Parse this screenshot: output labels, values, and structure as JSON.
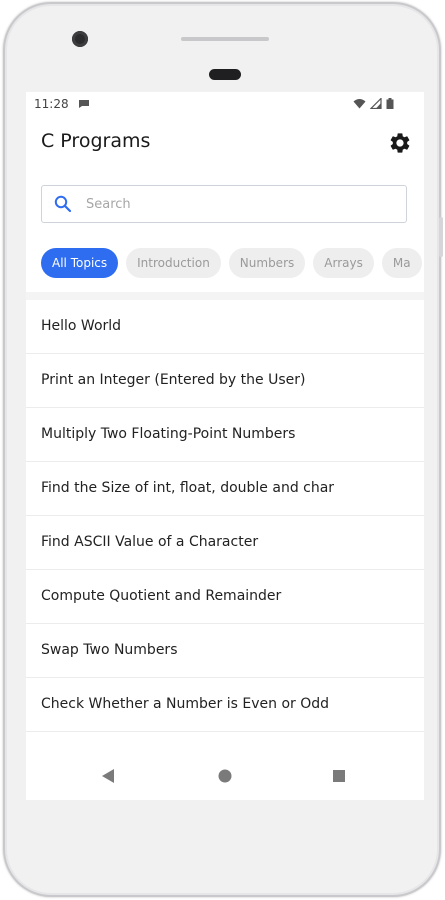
{
  "status_bar": {
    "time": "11:28"
  },
  "app_bar": {
    "title": "C Programs",
    "settings_icon": "gear-icon"
  },
  "search": {
    "placeholder": "Search",
    "value": "",
    "icon": "search-icon"
  },
  "chips": [
    {
      "label": "All Topics",
      "selected": true
    },
    {
      "label": "Introduction",
      "selected": false
    },
    {
      "label": "Numbers",
      "selected": false
    },
    {
      "label": "Arrays",
      "selected": false
    },
    {
      "label": "Ma",
      "selected": false
    }
  ],
  "topics": [
    "Hello World",
    "Print an Integer (Entered by the User)",
    "Multiply Two Floating-Point Numbers",
    "Find the Size of int, float, double and char",
    "Find ASCII Value of a Character",
    "Compute Quotient and Remainder",
    "Swap Two Numbers",
    "Check Whether a Number is Even or Odd"
  ],
  "nav_bar": {
    "back_icon": "back-triangle-icon",
    "home_icon": "home-circle-icon",
    "recents_icon": "recents-square-icon"
  },
  "colors": {
    "accent": "#2f6df0",
    "chip_bg": "#eeeeee",
    "chip_text": "#9a9a9a",
    "text": "#222222"
  }
}
